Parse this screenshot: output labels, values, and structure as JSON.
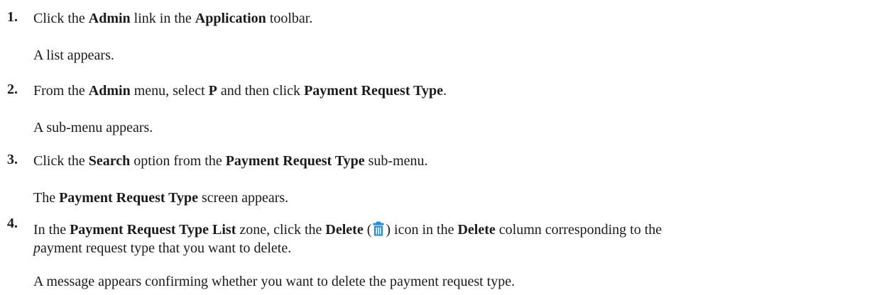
{
  "steps": [
    {
      "number": "1.",
      "text": {
        "t1": "Click the ",
        "b1": "Admin",
        "t2": " link in the ",
        "b2": "Application",
        "t3": " toolbar."
      },
      "result": "A list appears."
    },
    {
      "number": "2.",
      "text": {
        "t1": "From the ",
        "b1": "Admin",
        "t2": " menu, select ",
        "b2": "P",
        "t3": " and then click ",
        "b3": "Payment Request Type",
        "t4": "."
      },
      "result": "A sub-menu appears."
    },
    {
      "number": "3.",
      "text": {
        "t1": "Click the ",
        "b1": "Search",
        "t2": " option from the ",
        "b2": "Payment Request Type",
        "t3": " sub-menu."
      },
      "result": {
        "t1": "The ",
        "b1": "Payment Request Type",
        "t2": " screen appears."
      }
    },
    {
      "number": "4.",
      "text": {
        "t1": "In the ",
        "b1": "Payment Request Type List",
        "t2": " zone, click the ",
        "b2": "Delete",
        "t3": " (",
        "t4": ") icon in the ",
        "b3": "Delete",
        "t5": " column corresponding to the",
        "i1": "p",
        "t6": "ayment request type that you want to delete."
      },
      "result": "A message appears confirming whether you want to delete the payment request type."
    }
  ],
  "icons": {
    "delete": "trash-icon",
    "delete_color": "#1e88e5"
  }
}
